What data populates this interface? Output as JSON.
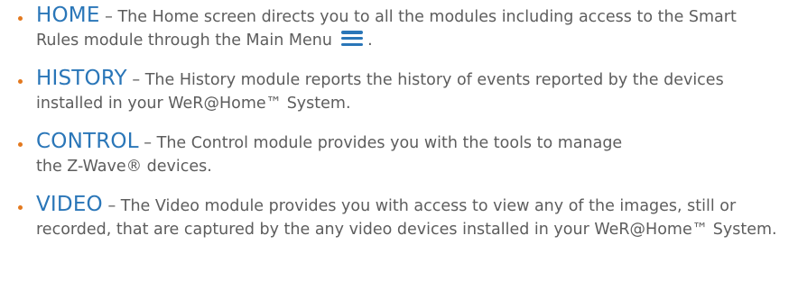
{
  "items": [
    {
      "term": "HOME",
      "dash": "–",
      "text": "The Home screen directs you to all the modules including access to the Smart Rules module through the Main Menu",
      "icon": "hamburger-menu-icon",
      "tail": "."
    },
    {
      "term": "HISTORY",
      "dash": "–",
      "text": "The History module reports the history of events reported by the devices installed in your WeR@Home™ System."
    },
    {
      "term": "CONTROL",
      "dash": "–",
      "text": "The Control module provides you with the tools to manage the Z-Wave® devices."
    },
    {
      "term": "VIDEO",
      "dash": "–",
      "text": "The Video module provides you with access to view any of the images, still or recorded, that are captured by the any video devices installed in your WeR@Home™ System."
    }
  ],
  "colors": {
    "term": "#2a76b8",
    "bullet": "#e3791f",
    "body_text": "#5d5d5d"
  }
}
